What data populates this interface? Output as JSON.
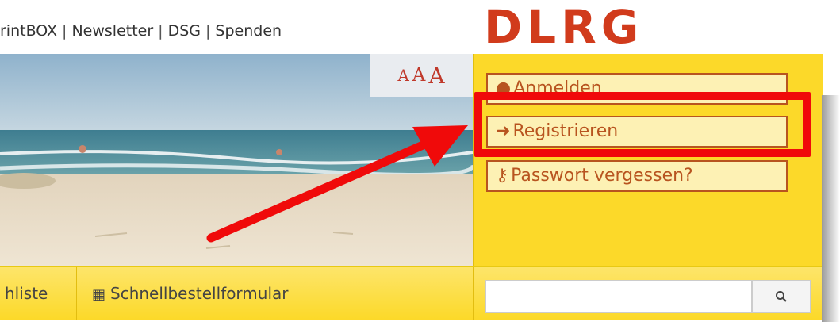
{
  "topnav": {
    "items": [
      "rintBOX",
      "Newsletter",
      "DSG",
      "Spenden"
    ],
    "separator": "|"
  },
  "logo": {
    "text": "DLRG",
    "color": "#d13b1c"
  },
  "font_size_control": {
    "labels": [
      "A",
      "A",
      "A"
    ]
  },
  "panel": {
    "login_label": "Anmelden",
    "login_icon": "person-icon",
    "register_label": "Registrieren",
    "register_icon": "sign-in-icon",
    "forgot_label": "Passwort vergessen?",
    "forgot_icon": "key-icon",
    "accent": "#fcd929"
  },
  "bottombar": {
    "wishlist_label": "hliste",
    "quickorder_label": "Schnellbestellformular",
    "quickorder_icon": "grid-icon"
  },
  "search": {
    "value": "",
    "icon": "search-icon"
  },
  "annotation": {
    "highlight_color": "#f00a0a"
  }
}
